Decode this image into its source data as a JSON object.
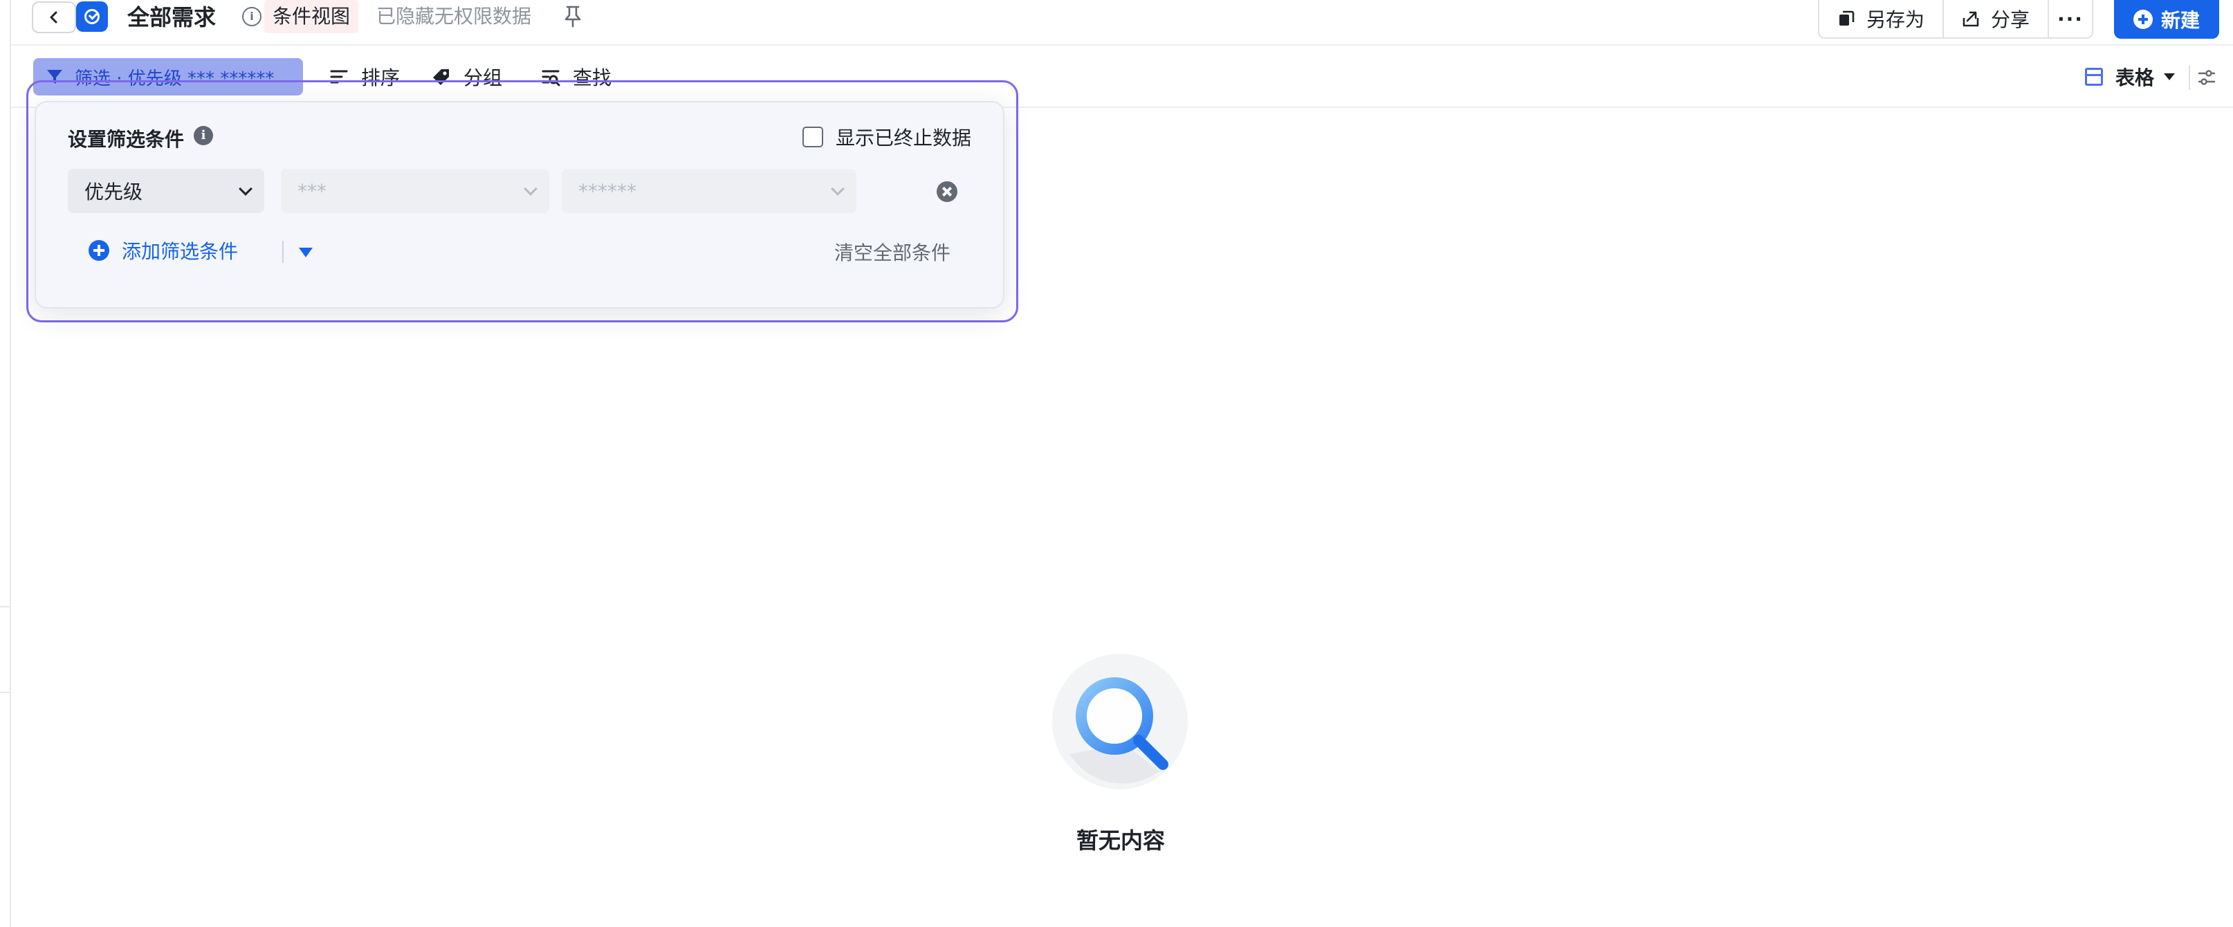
{
  "header": {
    "title": "全部需求",
    "view_tag": "条件视图",
    "hidden_note": "已隐藏无权限数据",
    "save_as_label": "另存为",
    "share_label": "分享",
    "more_label": "···",
    "new_label": "新建",
    "accent_color": "#1764e8"
  },
  "toolbar": {
    "filter_label": "筛选 · 优先级 *** ******",
    "sort_label": "排序",
    "group_label": "分组",
    "find_label": "查找",
    "view_label": "表格"
  },
  "filter_panel": {
    "title": "设置筛选条件",
    "show_ended_label": "显示已终止数据",
    "show_ended_checked": false,
    "condition": {
      "field": "优先级",
      "operator": "***",
      "value": "******"
    },
    "add_condition_label": "添加筛选条件",
    "clear_all_label": "清空全部条件"
  },
  "empty_state": {
    "text": "暂无内容"
  }
}
